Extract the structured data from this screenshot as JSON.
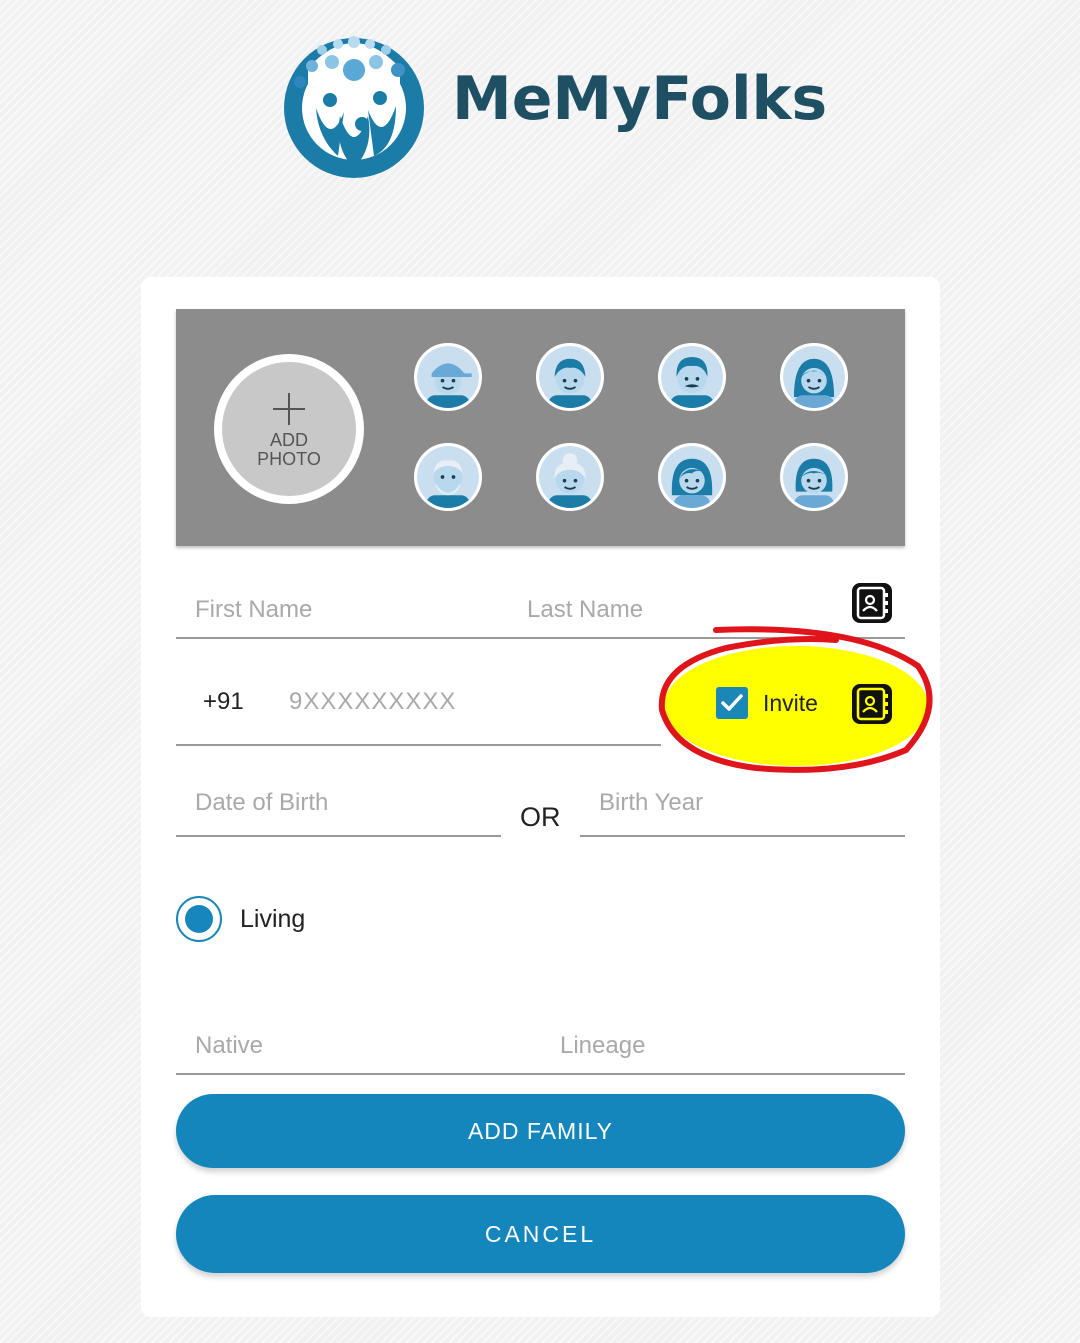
{
  "brand": {
    "name": "MeMyFolks",
    "primary_color": "#1486bb",
    "text_color": "#1e4f63"
  },
  "photo_picker": {
    "add_photo_label_line1": "ADD",
    "add_photo_label_line2": "PHOTO",
    "avatars": [
      "boy-cap-avatar",
      "boy-avatar",
      "man-mustache-avatar",
      "girl-avatar",
      "grandfather-avatar",
      "grandmother-avatar",
      "woman-avatar",
      "girl-short-hair-avatar"
    ]
  },
  "form": {
    "first_name_placeholder": "First Name",
    "last_name_placeholder": "Last Name",
    "country_code": "+91",
    "phone_placeholder": "9XXXXXXXXX",
    "invite_label": "Invite",
    "invite_checked": true,
    "dob_placeholder": "Date of Birth",
    "or_label": "OR",
    "birth_year_placeholder": "Birth Year",
    "living_label": "Living",
    "living_selected": true,
    "native_placeholder": "Native",
    "lineage_placeholder": "Lineage"
  },
  "actions": {
    "add_family": "ADD FAMILY",
    "cancel": "CANCEL"
  },
  "annotation": {
    "highlight_color": "#ffff00",
    "circle_color": "#e0141b"
  }
}
